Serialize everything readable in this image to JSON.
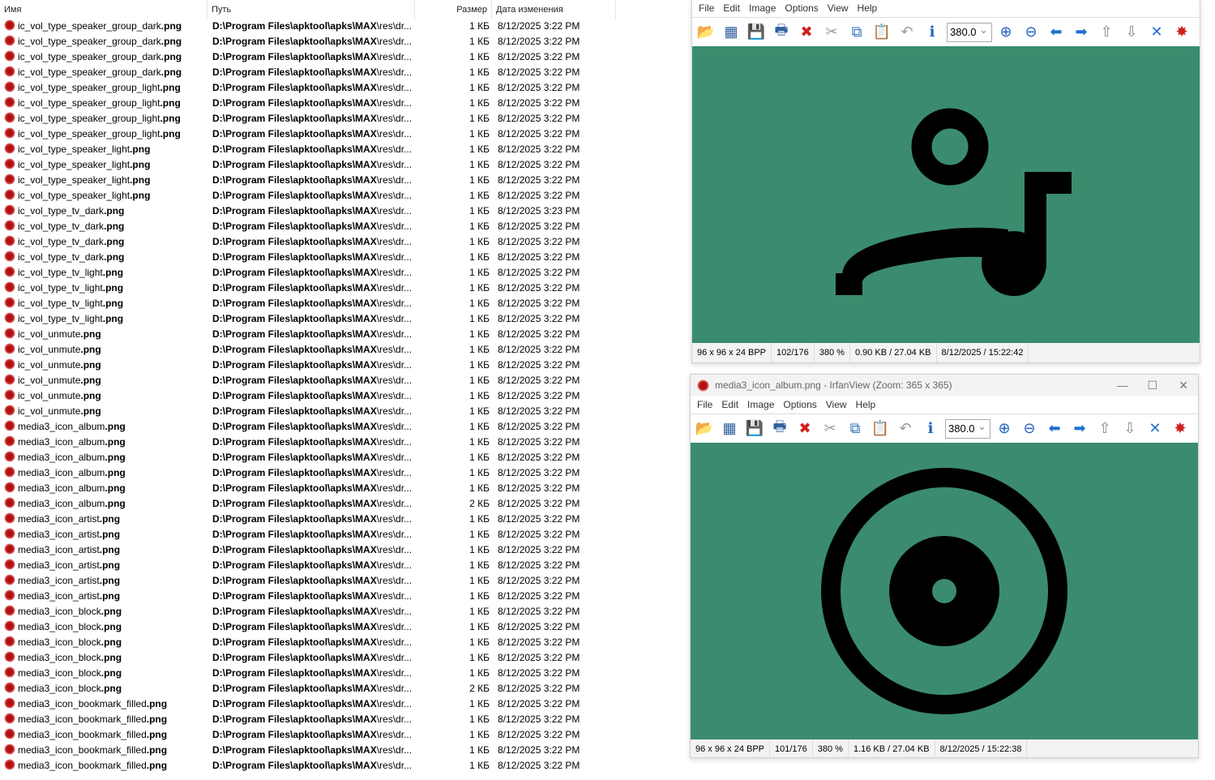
{
  "explorer": {
    "columns": {
      "name": "Имя",
      "path": "Путь",
      "size": "Размер",
      "date": "Дата изменения"
    },
    "rows": [
      {
        "stem": "ic_vol_type_speaker_group_dark",
        "ext": ".png",
        "size": "1 КБ",
        "date": "8/12/2025 3:22 PM"
      },
      {
        "stem": "ic_vol_type_speaker_group_dark",
        "ext": ".png",
        "size": "1 КБ",
        "date": "8/12/2025 3:22 PM"
      },
      {
        "stem": "ic_vol_type_speaker_group_dark",
        "ext": ".png",
        "size": "1 КБ",
        "date": "8/12/2025 3:22 PM"
      },
      {
        "stem": "ic_vol_type_speaker_group_dark",
        "ext": ".png",
        "size": "1 КБ",
        "date": "8/12/2025 3:22 PM"
      },
      {
        "stem": "ic_vol_type_speaker_group_light",
        "ext": ".png",
        "size": "1 КБ",
        "date": "8/12/2025 3:22 PM"
      },
      {
        "stem": "ic_vol_type_speaker_group_light",
        "ext": ".png",
        "size": "1 КБ",
        "date": "8/12/2025 3:22 PM"
      },
      {
        "stem": "ic_vol_type_speaker_group_light",
        "ext": ".png",
        "size": "1 КБ",
        "date": "8/12/2025 3:22 PM"
      },
      {
        "stem": "ic_vol_type_speaker_group_light",
        "ext": ".png",
        "size": "1 КБ",
        "date": "8/12/2025 3:22 PM"
      },
      {
        "stem": "ic_vol_type_speaker_light",
        "ext": ".png",
        "size": "1 КБ",
        "date": "8/12/2025 3:22 PM"
      },
      {
        "stem": "ic_vol_type_speaker_light",
        "ext": ".png",
        "size": "1 КБ",
        "date": "8/12/2025 3:22 PM"
      },
      {
        "stem": "ic_vol_type_speaker_light",
        "ext": ".png",
        "size": "1 КБ",
        "date": "8/12/2025 3:22 PM"
      },
      {
        "stem": "ic_vol_type_speaker_light",
        "ext": ".png",
        "size": "1 КБ",
        "date": "8/12/2025 3:22 PM"
      },
      {
        "stem": "ic_vol_type_tv_dark",
        "ext": ".png",
        "size": "1 КБ",
        "date": "8/12/2025 3:23 PM"
      },
      {
        "stem": "ic_vol_type_tv_dark",
        "ext": ".png",
        "size": "1 КБ",
        "date": "8/12/2025 3:22 PM"
      },
      {
        "stem": "ic_vol_type_tv_dark",
        "ext": ".png",
        "size": "1 КБ",
        "date": "8/12/2025 3:22 PM"
      },
      {
        "stem": "ic_vol_type_tv_dark",
        "ext": ".png",
        "size": "1 КБ",
        "date": "8/12/2025 3:22 PM"
      },
      {
        "stem": "ic_vol_type_tv_light",
        "ext": ".png",
        "size": "1 КБ",
        "date": "8/12/2025 3:22 PM"
      },
      {
        "stem": "ic_vol_type_tv_light",
        "ext": ".png",
        "size": "1 КБ",
        "date": "8/12/2025 3:22 PM"
      },
      {
        "stem": "ic_vol_type_tv_light",
        "ext": ".png",
        "size": "1 КБ",
        "date": "8/12/2025 3:22 PM"
      },
      {
        "stem": "ic_vol_type_tv_light",
        "ext": ".png",
        "size": "1 КБ",
        "date": "8/12/2025 3:22 PM"
      },
      {
        "stem": "ic_vol_unmute",
        "ext": ".png",
        "size": "1 КБ",
        "date": "8/12/2025 3:22 PM"
      },
      {
        "stem": "ic_vol_unmute",
        "ext": ".png",
        "size": "1 КБ",
        "date": "8/12/2025 3:22 PM"
      },
      {
        "stem": "ic_vol_unmute",
        "ext": ".png",
        "size": "1 КБ",
        "date": "8/12/2025 3:22 PM"
      },
      {
        "stem": "ic_vol_unmute",
        "ext": ".png",
        "size": "1 КБ",
        "date": "8/12/2025 3:22 PM"
      },
      {
        "stem": "ic_vol_unmute",
        "ext": ".png",
        "size": "1 КБ",
        "date": "8/12/2025 3:22 PM"
      },
      {
        "stem": "ic_vol_unmute",
        "ext": ".png",
        "size": "1 КБ",
        "date": "8/12/2025 3:22 PM"
      },
      {
        "stem": "media3_icon_album",
        "ext": ".png",
        "size": "1 КБ",
        "date": "8/12/2025 3:22 PM"
      },
      {
        "stem": "media3_icon_album",
        "ext": ".png",
        "size": "1 КБ",
        "date": "8/12/2025 3:22 PM"
      },
      {
        "stem": "media3_icon_album",
        "ext": ".png",
        "size": "1 КБ",
        "date": "8/12/2025 3:22 PM"
      },
      {
        "stem": "media3_icon_album",
        "ext": ".png",
        "size": "1 КБ",
        "date": "8/12/2025 3:22 PM"
      },
      {
        "stem": "media3_icon_album",
        "ext": ".png",
        "size": "1 КБ",
        "date": "8/12/2025 3:22 PM"
      },
      {
        "stem": "media3_icon_album",
        "ext": ".png",
        "size": "2 КБ",
        "date": "8/12/2025 3:22 PM"
      },
      {
        "stem": "media3_icon_artist",
        "ext": ".png",
        "size": "1 КБ",
        "date": "8/12/2025 3:22 PM"
      },
      {
        "stem": "media3_icon_artist",
        "ext": ".png",
        "size": "1 КБ",
        "date": "8/12/2025 3:22 PM"
      },
      {
        "stem": "media3_icon_artist",
        "ext": ".png",
        "size": "1 КБ",
        "date": "8/12/2025 3:22 PM"
      },
      {
        "stem": "media3_icon_artist",
        "ext": ".png",
        "size": "1 КБ",
        "date": "8/12/2025 3:22 PM"
      },
      {
        "stem": "media3_icon_artist",
        "ext": ".png",
        "size": "1 КБ",
        "date": "8/12/2025 3:22 PM"
      },
      {
        "stem": "media3_icon_artist",
        "ext": ".png",
        "size": "1 КБ",
        "date": "8/12/2025 3:22 PM"
      },
      {
        "stem": "media3_icon_block",
        "ext": ".png",
        "size": "1 КБ",
        "date": "8/12/2025 3:22 PM"
      },
      {
        "stem": "media3_icon_block",
        "ext": ".png",
        "size": "1 КБ",
        "date": "8/12/2025 3:22 PM"
      },
      {
        "stem": "media3_icon_block",
        "ext": ".png",
        "size": "1 КБ",
        "date": "8/12/2025 3:22 PM"
      },
      {
        "stem": "media3_icon_block",
        "ext": ".png",
        "size": "1 КБ",
        "date": "8/12/2025 3:22 PM"
      },
      {
        "stem": "media3_icon_block",
        "ext": ".png",
        "size": "1 КБ",
        "date": "8/12/2025 3:22 PM"
      },
      {
        "stem": "media3_icon_block",
        "ext": ".png",
        "size": "2 КБ",
        "date": "8/12/2025 3:22 PM"
      },
      {
        "stem": "media3_icon_bookmark_filled",
        "ext": ".png",
        "size": "1 КБ",
        "date": "8/12/2025 3:22 PM"
      },
      {
        "stem": "media3_icon_bookmark_filled",
        "ext": ".png",
        "size": "1 КБ",
        "date": "8/12/2025 3:22 PM"
      },
      {
        "stem": "media3_icon_bookmark_filled",
        "ext": ".png",
        "size": "1 КБ",
        "date": "8/12/2025 3:22 PM"
      },
      {
        "stem": "media3_icon_bookmark_filled",
        "ext": ".png",
        "size": "1 КБ",
        "date": "8/12/2025 3:22 PM"
      },
      {
        "stem": "media3_icon_bookmark_filled",
        "ext": ".png",
        "size": "1 КБ",
        "date": "8/12/2025 3:22 PM"
      }
    ],
    "path_bold": "D:\\Program Files\\apktool\\apks\\MAX",
    "path_rest": "\\res\\dr..."
  },
  "viewer_menu": [
    "File",
    "Edit",
    "Image",
    "Options",
    "View",
    "Help"
  ],
  "zoom_value": "380.0",
  "viewer1": {
    "status": [
      "96 x 96 x 24 BPP",
      "102/176",
      "380 %",
      "0.90 KB / 27.04 KB",
      "8/12/2025 / 15:22:42"
    ]
  },
  "viewer2": {
    "title": "media3_icon_album.png - IrfanView (Zoom: 365 x 365)",
    "status": [
      "96 x 96 x 24 BPP",
      "101/176",
      "380 %",
      "1.16 KB / 27.04 KB",
      "8/12/2025 / 15:22:38"
    ]
  },
  "colors": {
    "canvas": "#3b8c6e",
    "icon": "#000000"
  }
}
